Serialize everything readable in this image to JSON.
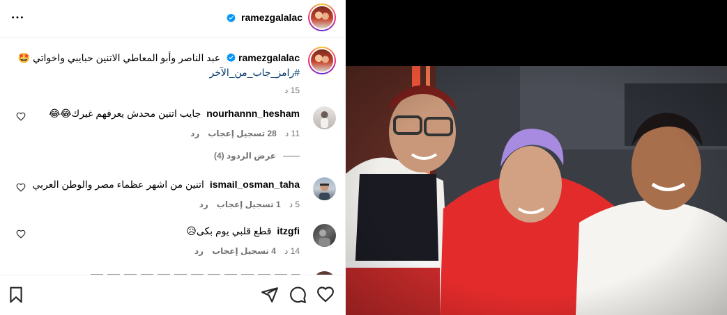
{
  "post": {
    "username": "ramezgalalac",
    "caption_text": "عبد الناصر وأبو المعاطي الاتنين حبايبي واخواتي 🤩",
    "hashtag": "#رامز_جاب_من_الآخر",
    "time": "15 د"
  },
  "comments": [
    {
      "username": "nourhannn_hesham",
      "text": "جايب اتنين محدش يعرفهم غيرك😂😂",
      "time": "11 د",
      "likes": "28 تسجيل إعجاب",
      "reply": "رد"
    },
    {
      "username": "ismail_osman_taha",
      "text": "اتنين من اشهر عظماء مصر والوطن العربي",
      "time": "5 د",
      "likes": "1 تسجيل إعجاب",
      "reply": "رد"
    },
    {
      "username": "itzgfi",
      "text": "قطع قلبي يوم بكى😥",
      "time": "14 د",
      "likes": "4 تسجيل إعجاب",
      "reply": "رد"
    }
  ],
  "view_replies": "عرض الردود (4)",
  "icons": {
    "more": "more-icon",
    "verified": "verified-badge-icon",
    "like": "heart-icon",
    "comment": "comment-icon",
    "share": "share-icon",
    "save": "bookmark-icon"
  },
  "colors": {
    "verified": "#0095f6",
    "secondary_text": "#737373",
    "hashtag": "#00376b"
  }
}
